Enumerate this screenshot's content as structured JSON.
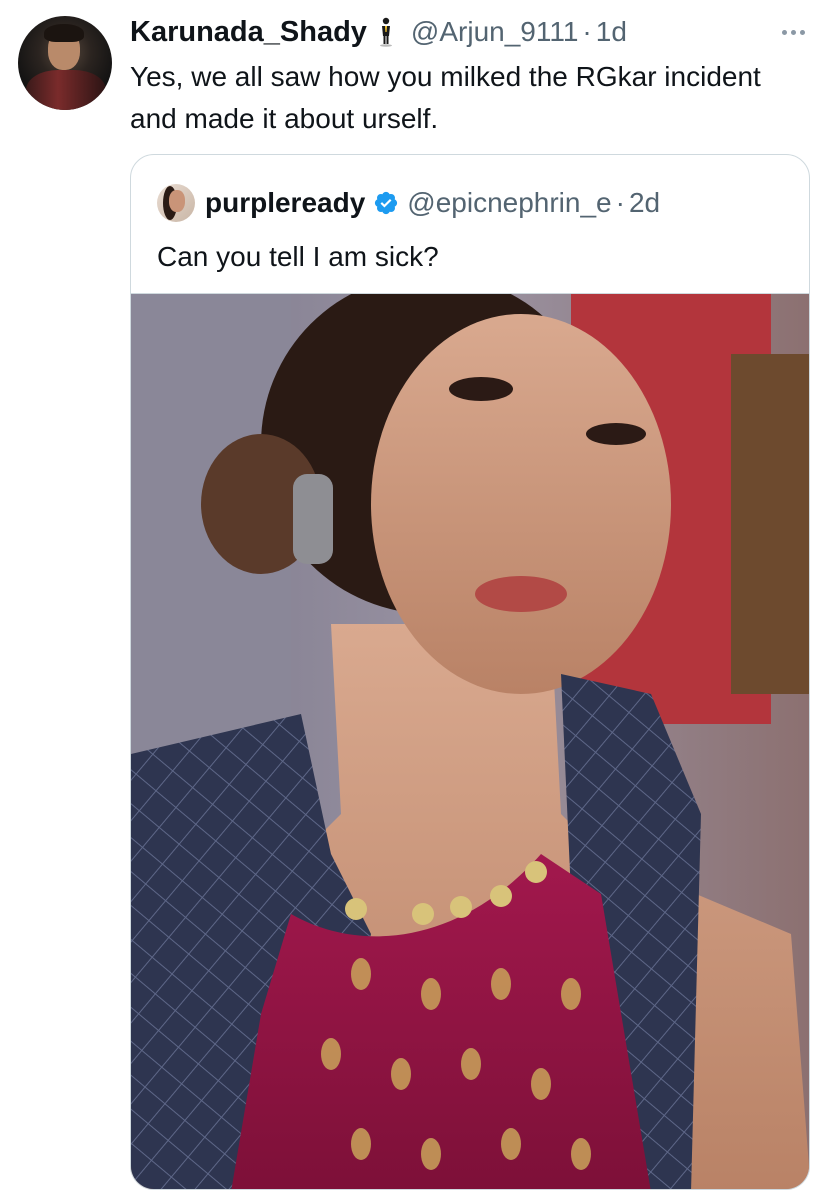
{
  "tweet": {
    "author_name": "Karunada_Shady",
    "author_emoji": "man-in-suit-levitating",
    "author_handle": "@Arjun_9111",
    "separator": "·",
    "timestamp": "1d",
    "text": "Yes, we all saw how you milked the RGkar incident and made it about urself.",
    "more_icon": "more-horizontal-icon"
  },
  "quote": {
    "author_name": "purpleready",
    "verified": true,
    "verified_color": "#1d9bf0",
    "author_handle": "@epicnephrin_e",
    "separator": "·",
    "timestamp": "2d",
    "text": "Can you tell I am sick?",
    "media_description": ""
  },
  "colors": {
    "text_primary": "#0f1419",
    "text_secondary": "#536471",
    "border": "#cfd9de"
  }
}
